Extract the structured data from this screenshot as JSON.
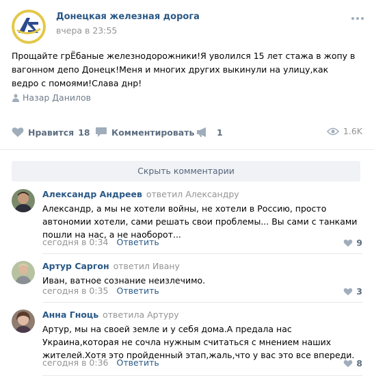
{
  "post": {
    "group_name": "Донецкая железная дорога",
    "time": "вчера в 23:55",
    "text": "Прощайте грЁбаные железнодорожники!Я уволился 15 лет стажа в жопу в вагонном депо Донецк!Меня и многих других выкинули на улицу,как ведро с помоями!Слава днр!",
    "author": "Назар Данилов"
  },
  "actions": {
    "like_label": "Нравится",
    "like_count": "18",
    "comment_label": "Комментировать",
    "share_count": "1",
    "views": "1.6K"
  },
  "comments_panel": {
    "hide_label": "Скрыть комментарии"
  },
  "comments": [
    {
      "name": "Александр Андреев",
      "reply": "ответил Александру",
      "text": "Александр, а мы не хотели войны, не хотели в Россию, просто автономии хотели, сами решать свои проблемы... Вы сами с танками пошли на нас, а не наоборот...",
      "time": "сегодня в 0:34",
      "answer": "Ответить",
      "likes": "9"
    },
    {
      "name": "Артур Саргон",
      "reply": "ответил Ивану",
      "text": "Иван, ватное сознание неизлечимо.",
      "time": "сегодня в 0:35",
      "answer": "Ответить",
      "likes": "3"
    },
    {
      "name": "Анна Гноць",
      "reply": "ответила Артуру",
      "text": "Артур, мы на своей земле и у себя дома.А предала нас Украина,которая не сочла нужным считаться с мнением наших жителей.Хотя это пройденный этап,жаль,что у вас это все впереди.",
      "time": "сегодня в 0:36",
      "answer": "Ответить",
      "likes": "8"
    }
  ],
  "colors": {
    "link": "#2a5885",
    "muted": "#939393",
    "action": "#5e6e81",
    "icon": "#a0adbb"
  }
}
